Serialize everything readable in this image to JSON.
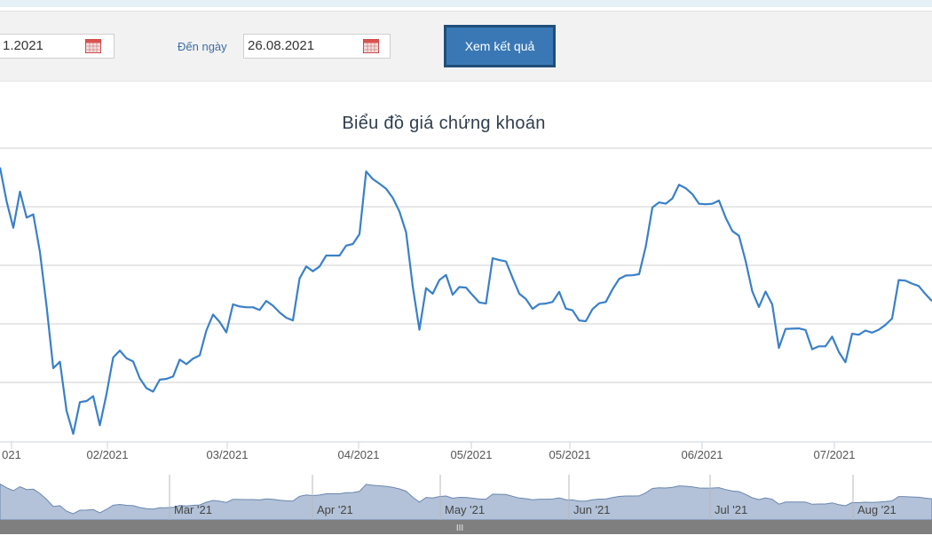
{
  "toolbar": {
    "from_date_value": "1.2021",
    "to_label": "Đến ngày",
    "to_date_value": "26.08.2021",
    "submit_label": "Xem kết quả"
  },
  "chart_data": {
    "type": "line",
    "title": "Biểu đồ giá chứng khoán",
    "xlabel": "",
    "ylabel": "",
    "grid": true,
    "x_tick_labels": [
      "021",
      "02/2021",
      "03/2021",
      "04/2021",
      "05/2021",
      "05/2021",
      "06/2021",
      "07/2021"
    ],
    "series": [
      {
        "values": [
          92.8,
          80.0,
          70.2,
          83.7,
          74.0,
          75.2,
          61.1,
          40.7,
          17.6,
          20.0,
          1.6,
          -7.0,
          4.9,
          5.3,
          7.1,
          -3.8,
          7.9,
          21.6,
          24.2,
          21.3,
          20.1,
          13.8,
          10.1,
          8.8,
          13.3,
          13.6,
          14.5,
          20.8,
          19.1,
          21.2,
          22.4,
          31.7,
          37.7,
          34.9,
          31.0,
          41.5,
          40.7,
          40.4,
          40.4,
          39.4,
          42.8,
          41.0,
          38.5,
          36.5,
          35.5,
          51.2,
          55.7,
          53.9,
          55.7,
          59.8,
          59.8,
          59.8,
          63.5,
          64.1,
          67.8,
          91.3,
          88.4,
          86.7,
          84.8,
          81.4,
          76.3,
          68.5,
          48.2,
          32.0,
          47.6,
          45.5,
          50.6,
          52.5,
          45.1,
          48.0,
          47.8,
          44.9,
          42.2,
          41.8,
          58.8,
          58.1,
          57.6,
          51.4,
          45.5,
          43.5,
          39.8,
          41.6,
          41.8,
          42.4,
          46.2,
          39.9,
          39.3,
          35.5,
          35.2,
          39.7,
          41.9,
          42.4,
          47.1,
          51.0,
          52.3,
          52.4,
          52.8,
          63.1,
          77.8,
          79.7,
          79.2,
          81.2,
          86.3,
          85.0,
          82.8,
          79.2,
          79.0,
          79.2,
          80.4,
          74.0,
          69.0,
          67.2,
          57.8,
          46.4,
          40.5,
          46.3,
          41.5,
          25.2,
          32.3,
          32.4,
          32.5,
          31.9,
          24.7,
          25.8,
          25.8,
          29.4,
          23.7,
          19.8,
          30.5,
          30.1,
          31.7,
          30.9,
          32.0,
          33.8,
          36.2,
          50.6,
          50.4,
          49.3,
          48.4,
          45.4,
          42.7
        ]
      }
    ]
  },
  "navigator": {
    "labels": [
      "Mar '21",
      "Apr '21",
      "May '21",
      "Jun '21",
      "Jul '21",
      "Aug '21"
    ],
    "scrollbar_grip": "III"
  },
  "colors": {
    "line": "#3a80c8",
    "navigator_fill": "#b3c2d8",
    "navigator_line": "#6a86b0",
    "button": "#3a78b5",
    "scrollbar": "#7f7f7f"
  }
}
